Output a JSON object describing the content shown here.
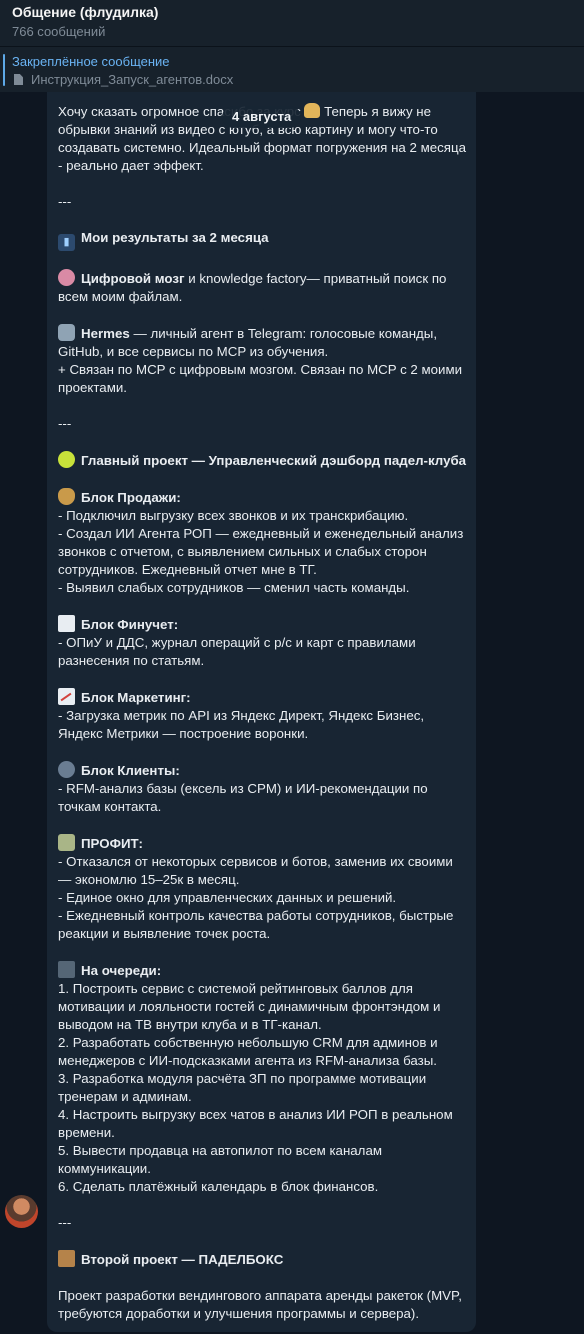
{
  "header": {
    "title": "Общение (флудилка)",
    "subtitle": "766 сообщений"
  },
  "pinned": {
    "title": "Закреплённое сообщение",
    "file": "Инструкция_Запуск_агентов.docx"
  },
  "date_badge": "4 августа",
  "message": {
    "intro": "Хочу сказать огромное спасибо за курс",
    "intro2": "Теперь я вижу не обрывки знаний из видео с ютуб, а всю картину и могу что-то создавать системно. Идеальный формат погружения на 2 месяца - реально дает эффект.",
    "sep": "---",
    "results_title": "Мои результаты за 2 месяца",
    "brain_title": "Цифровой мозг",
    "brain_text": " и knowledge factory— приватный поиск по всем моим файлам.",
    "hermes_title": "Hermes",
    "hermes_text": " — личный агент в Telegram: голосовые команды, GitHub, и все сервисы по MCP из обучения.",
    "hermes_text2": "+ Связан по MCP с цифровым мозгом. Связан по MCP с 2 моими проектами.",
    "main_project": "Главный проект — Управленческий дэшборд падел-клуба",
    "sales_title": "Блок Продажи:",
    "sales": [
      "- Подключил выгрузку всех звонков и их транскрибацию.",
      "- Создал ИИ Агента РОП — ежедневный и еженедельный анализ звонков с отчетом, с выявлением сильных и слабых сторон сотрудников. Ежедневный отчет мне в ТГ.",
      "- Выявил слабых сотрудников — сменил часть команды."
    ],
    "fin_title": "Блок Финучет:",
    "fin": [
      "- ОПиУ и ДДС, журнал операций с р/с и карт с правилами разнесения по статьям."
    ],
    "mkt_title": "Блок Маркетинг:",
    "mkt": [
      "- Загрузка метрик по API из Яндекс Директ, Яндекс Бизнес, Яндекс Метрики — построение воронки."
    ],
    "clients_title": "Блок Клиенты:",
    "clients": [
      "- RFM-анализ базы (ексель из CPM) и ИИ-рекомендации по точкам контакта."
    ],
    "profit_title": "ПРОФИТ:",
    "profit": [
      "- Отказался от некоторых сервисов и ботов, заменив их своими — экономлю 15–25к в месяц.",
      "- Единое окно для управленческих данных и решений.",
      "- Ежедневный контроль качества работы сотрудников, быстрые реакции и выявление точек роста."
    ],
    "next_title": "На очереди:",
    "next": [
      "1. Построить сервис с системой рейтинговых баллов для мотивации и лояльности гостей с динамичным фронтэндом и выводом на ТВ внутри клуба и в ТГ-канал.",
      "2. Разработать собственную небольшую CRM для админов и менеджеров с ИИ-подсказками агента из RFM-анализа базы.",
      "3. Разработка модуля расчёта ЗП по программе мотивации тренерам и админам.",
      "4. Настроить выгрузку всех чатов в анализ ИИ РОП в реальном времени.",
      "5. Вывести продавца на автопилот по всем каналам коммуникации.",
      "6. Сделать платёжный календарь в блок финансов."
    ],
    "second_project": "Второй проект — ПАДЕЛБОКС",
    "second_text": "Проект разработки вендингового аппарата аренды ракеток (MVP, требуются доработки и улучшения программы и сервера)."
  },
  "icons": [
    "pray-emoji",
    "chart-emoji",
    "brain-emoji",
    "robot-emoji",
    "tennis-emoji",
    "money-bag-emoji",
    "memo-emoji",
    "chart-up-emoji",
    "people-emoji",
    "money-wings-emoji",
    "soon-arrow-emoji",
    "package-emoji",
    "document-icon"
  ]
}
